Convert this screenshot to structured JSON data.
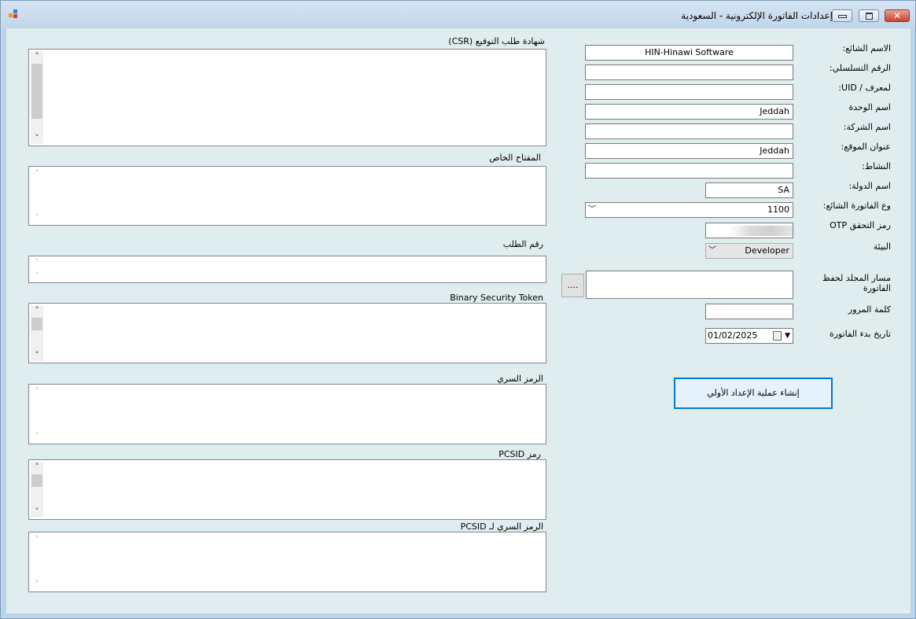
{
  "window": {
    "title": "إعدادات الفاتورة الإلكترونية - السعودية",
    "colors": {
      "close": "#c7452f",
      "primary_border": "#0078d7",
      "client_bg": "#e0edef"
    }
  },
  "form": {
    "common_name": {
      "label": "الاسم الشائع:",
      "value": "HIN-Hinawi Software"
    },
    "serial_number": {
      "label": "الرقم التسلسلي:",
      "value": ""
    },
    "uid": {
      "label": "لمعرف / UID:",
      "value": ""
    },
    "unit_name": {
      "label": "اسم الوحدة",
      "value": "Jeddah"
    },
    "company_name": {
      "label": "اسم الشركة:",
      "value": ""
    },
    "site_address": {
      "label": "عنوان الموقع:",
      "value": "Jeddah"
    },
    "activity": {
      "label": "النشاط:",
      "value": ""
    },
    "country": {
      "label": "اسم الدولة:",
      "value": "SA"
    },
    "invoice_type": {
      "label": "وع الفاتورة الشائع:",
      "value": "1100"
    },
    "otp": {
      "label": "رمز التحقق OTP",
      "value": ""
    },
    "environment": {
      "label": "البيئة",
      "value": "Developer"
    },
    "folder_path": {
      "label": "مسار المجلد لحفظ الفاتورة",
      "value": "",
      "browse_label": "...."
    },
    "password": {
      "label": "كلمة المرور",
      "value": ""
    },
    "start_date": {
      "label": "تاريخ بدء الفاتورة",
      "value": "01/02/2025"
    },
    "create_button": "إنشاء عملية الإعداد الأولي"
  },
  "text_areas": {
    "csr": {
      "label": "شهادة طلب التوقيع (CSR)"
    },
    "private_key": {
      "label": "المفتاح الخاص"
    },
    "request_id": {
      "label": "رقم الطلب"
    },
    "binary_token": {
      "label": "Binary Security Token"
    },
    "secret": {
      "label": "الرمز السري"
    },
    "pcsid": {
      "label": "رمز PCSID"
    },
    "pcsid_secret": {
      "label": "الرمز السري لـ PCSID"
    }
  }
}
